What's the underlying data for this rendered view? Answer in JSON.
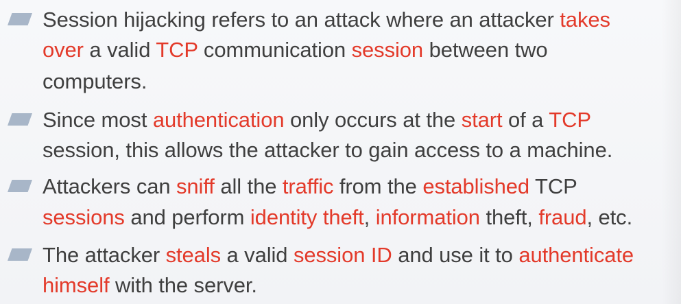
{
  "theme": {
    "text_color": "#3f3f3f",
    "accent_color": "#e33a2a",
    "bullet_color": "#a8b6c8",
    "background_color": "#f4f5f7"
  },
  "bullets": [
    {
      "lines": [
        [
          "Session hijacking refers to an attack where an attacker ",
          "takes"
        ],
        [
          "over",
          " a valid ",
          "TCP",
          " communication ",
          "session",
          " between two"
        ],
        [
          "computers."
        ]
      ]
    },
    {
      "lines": [
        [
          "Since most ",
          "authentication",
          " only occurs at the ",
          "start",
          " of a ",
          "TCP"
        ],
        [
          "session, this allows the attacker to gain access to a machine."
        ]
      ]
    },
    {
      "lines": [
        [
          "Attackers can ",
          "sniff",
          " all the ",
          "traffic",
          " from the ",
          "established",
          " TCP"
        ],
        [
          "sessions",
          " and perform ",
          "identity theft",
          ", ",
          "information",
          " theft, ",
          "fraud",
          ", etc."
        ]
      ]
    },
    {
      "lines": [
        [
          "The attacker ",
          "steals",
          " a valid ",
          "session ID",
          " and use it to ",
          "authenticate"
        ],
        [
          "himself",
          " with the server."
        ]
      ]
    }
  ]
}
